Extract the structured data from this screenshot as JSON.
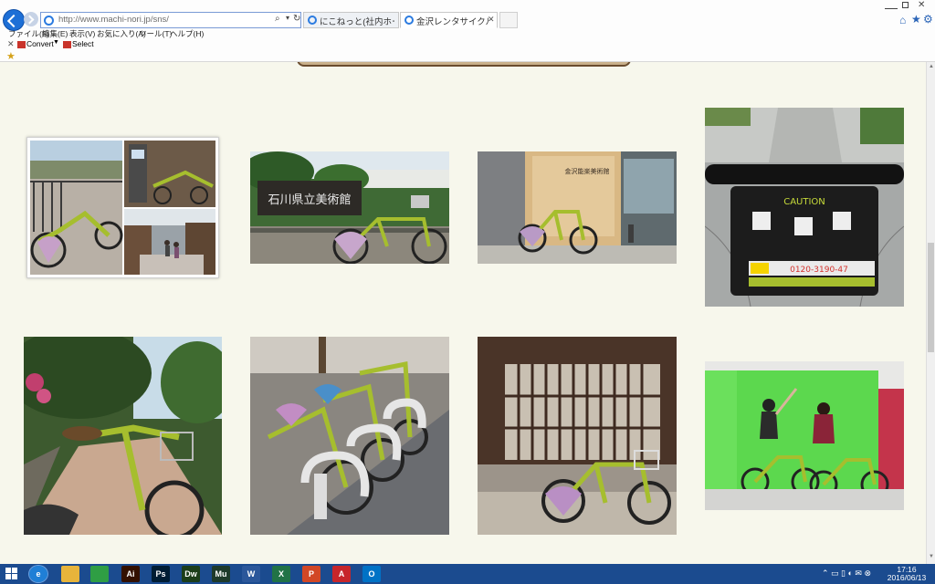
{
  "browser": {
    "address_url": "http://www.machi-nori.jp/sns/",
    "tabs": [
      {
        "label": "にこねっと(社内ホームページ)"
      },
      {
        "label": "金沢レンタサイクル「まちのり」|S..."
      }
    ],
    "menu": [
      "ファイル(F)",
      "編集(E)",
      "表示(V)",
      "お気に入り(A)",
      "ツール(T)",
      "ヘルプ(H)"
    ],
    "command_bar": {
      "convert_label": "Convert",
      "select_label": "Select"
    }
  },
  "photos": {
    "museum_sign": "石川県立美術館",
    "shopfront_sign": "金沢能楽美術館",
    "caution_title": "CAUTION",
    "caution_phone": "0120-3190-47"
  },
  "taskbar": {
    "apps": [
      {
        "name": "ie-icon",
        "label": "e",
        "color": "#1f7fd6"
      },
      {
        "name": "explorer-icon",
        "label": "",
        "color": "#e7b43b"
      },
      {
        "name": "store-icon",
        "label": "",
        "color": "#2f9e44"
      },
      {
        "name": "illustrator-icon",
        "label": "Ai",
        "color": "#331000"
      },
      {
        "name": "photoshop-icon",
        "label": "Ps",
        "color": "#001d34"
      },
      {
        "name": "dreamweaver-icon",
        "label": "Dw",
        "color": "#1c3e1a"
      },
      {
        "name": "muse-icon",
        "label": "Mu",
        "color": "#1e3a2a"
      },
      {
        "name": "word-icon",
        "label": "W",
        "color": "#2b579a"
      },
      {
        "name": "excel-icon",
        "label": "X",
        "color": "#217346"
      },
      {
        "name": "powerpoint-icon",
        "label": "P",
        "color": "#d24726"
      },
      {
        "name": "acrobat-icon",
        "label": "A",
        "color": "#c7262b"
      },
      {
        "name": "outlook-icon",
        "label": "O",
        "color": "#0072c6"
      }
    ],
    "time": "17:16",
    "date": "2016/06/13"
  }
}
